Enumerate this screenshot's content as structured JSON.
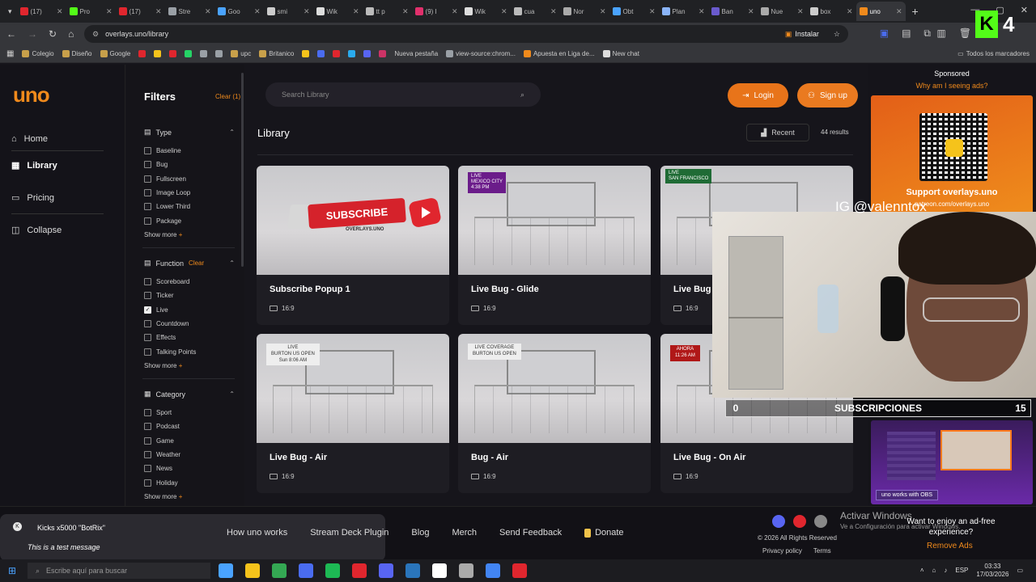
{
  "browser": {
    "tabs": [
      {
        "label": "(17)",
        "color": "#e0262e"
      },
      {
        "label": "Pro",
        "color": "#53fc18"
      },
      {
        "label": "(17)",
        "color": "#e0262e"
      },
      {
        "label": "Stre",
        "color": "#9aa0a6"
      },
      {
        "label": "Goo",
        "color": "#4aa3ff"
      },
      {
        "label": "smi",
        "color": "#cccccc"
      },
      {
        "label": "Wik",
        "color": "#dddddd"
      },
      {
        "label": "tt p",
        "color": "#bbbbbb"
      },
      {
        "label": "(9) I",
        "color": "#e1306c"
      },
      {
        "label": "Wik",
        "color": "#dddddd"
      },
      {
        "label": "cua",
        "color": "#bbbbbb"
      },
      {
        "label": "Nor",
        "color": "#aaaaaa"
      },
      {
        "label": "Obt",
        "color": "#4aa3ff"
      },
      {
        "label": "Plan",
        "color": "#8ab4f8"
      },
      {
        "label": "Ban",
        "color": "#6a5acd"
      },
      {
        "label": "Nue",
        "color": "#aaaaaa"
      },
      {
        "label": "box",
        "color": "#cccccc"
      },
      {
        "label": "uno",
        "color": "#f08a1c",
        "active": true
      }
    ],
    "url": "overlays.uno/library",
    "install_label": "Instalar",
    "bookmarks": [
      {
        "label": "Colegio",
        "color": "#c8a04a"
      },
      {
        "label": "Diseño",
        "color": "#c8a04a"
      },
      {
        "label": "Google",
        "color": "#c8a04a"
      },
      {
        "label": "",
        "color": "#e0262e"
      },
      {
        "label": "",
        "color": "#f5c31b"
      },
      {
        "label": "",
        "color": "#e0262e"
      },
      {
        "label": "",
        "color": "#25d366"
      },
      {
        "label": "",
        "color": "#9aa0a6"
      },
      {
        "label": "",
        "color": "#9aa0a6"
      },
      {
        "label": "upc",
        "color": "#c8a04a"
      },
      {
        "label": "Britanico",
        "color": "#c8a04a"
      },
      {
        "label": "",
        "color": "#f5c31b"
      },
      {
        "label": "",
        "color": "#4a6cf0"
      },
      {
        "label": "",
        "color": "#e0262e"
      },
      {
        "label": "",
        "color": "#2aabee"
      },
      {
        "label": "",
        "color": "#5865f2"
      },
      {
        "label": "",
        "color": "#cc3366"
      },
      {
        "label": "Nueva pestaña",
        "color": ""
      },
      {
        "label": "view-source:chrom...",
        "color": "#9aa0a6"
      },
      {
        "label": "Apuesta en Liga de...",
        "color": "#f08a1c"
      },
      {
        "label": "New chat",
        "color": "#dddddd"
      }
    ],
    "all_bookmarks": "Todos los marcadores"
  },
  "sidebar": {
    "logo": "uno",
    "items": [
      {
        "label": "Home",
        "icon": "⌂"
      },
      {
        "label": "Library",
        "icon": "▦",
        "active": true
      },
      {
        "label": "Pricing",
        "icon": "▭"
      },
      {
        "label": "Collapse",
        "icon": "◫"
      }
    ]
  },
  "filters": {
    "title": "Filters",
    "clear_all": "Clear (1)",
    "sections": [
      {
        "title": "Type",
        "clear": "",
        "options": [
          {
            "label": "Baseline",
            "checked": false
          },
          {
            "label": "Bug",
            "checked": false
          },
          {
            "label": "Fullscreen",
            "checked": false
          },
          {
            "label": "Image Loop",
            "checked": false
          },
          {
            "label": "Lower Third",
            "checked": false
          },
          {
            "label": "Package",
            "checked": false
          }
        ],
        "more": "Show more"
      },
      {
        "title": "Function",
        "clear": "Clear",
        "options": [
          {
            "label": "Scoreboard",
            "checked": false
          },
          {
            "label": "Ticker",
            "checked": false
          },
          {
            "label": "Live",
            "checked": true
          },
          {
            "label": "Countdown",
            "checked": false
          },
          {
            "label": "Effects",
            "checked": false
          },
          {
            "label": "Talking Points",
            "checked": false
          }
        ],
        "more": "Show more"
      },
      {
        "title": "Category",
        "clear": "",
        "options": [
          {
            "label": "Sport",
            "checked": false
          },
          {
            "label": "Podcast",
            "checked": false
          },
          {
            "label": "Game",
            "checked": false
          },
          {
            "label": "Weather",
            "checked": false
          },
          {
            "label": "News",
            "checked": false
          },
          {
            "label": "Holiday",
            "checked": false
          }
        ],
        "more": "Show more"
      }
    ]
  },
  "header": {
    "search_placeholder": "Search Library",
    "login": "Login",
    "signup": "Sign up"
  },
  "library": {
    "title": "Library",
    "sort": "Recent",
    "results": "44 results",
    "cards": [
      {
        "title": "Subscribe Popup 1",
        "ratio": "16:9",
        "badge": "",
        "subscribe_text": "SUBSCRIBE",
        "subscribe_sub": "OVERLAYS.UNO"
      },
      {
        "title": "Live Bug - Glide",
        "ratio": "16:9",
        "badge": "LIVE",
        "badge_sub": "MEXICO CITY\n4:38 PM"
      },
      {
        "title": "Live Bug -",
        "ratio": "16:9",
        "badge": "LIVE",
        "badge_sub": "SAN FRANCISCO"
      },
      {
        "title": "Live Bug - Air",
        "ratio": "16:9",
        "badge": "LIVE",
        "badge_sub": "BURTON US OPEN\nSun 8:06 AM"
      },
      {
        "title": "Bug - Air",
        "ratio": "16:9",
        "badge": "LIVE COVERAGE",
        "badge_sub": "BURTON US OPEN"
      },
      {
        "title": "Live Bug - On Air",
        "ratio": "16:9",
        "badge": "AHORA",
        "badge_sub": "11:26 AM"
      }
    ]
  },
  "ad": {
    "sponsored": "Sponsored",
    "why": "Why am I seeing ads?",
    "headline": "Support overlays.uno",
    "url": "patreon.com/overlays.uno",
    "obs_tag": "uno works with OBS"
  },
  "overlay": {
    "ig": "IG @valenntox",
    "sub_left": "0",
    "sub_label": "SUBSCRIPCIONES",
    "sub_right": "15",
    "kick_count": "4"
  },
  "footer": {
    "links": [
      "How uno works",
      "Stream Deck Plugin",
      "Blog",
      "Merch",
      "Send Feedback",
      "Donate"
    ],
    "copyright": "© 2026 All Rights Reserved",
    "privacy": "Privacy policy",
    "terms": "Terms",
    "activate": "Activar Windows",
    "activate_sub": "Ve a Configuración para activar Windows.",
    "enjoy": "Want to enjoy an ad-free experience?",
    "remove_ads": "Remove Ads"
  },
  "toast": {
    "line1": "Kicks x5000 \"BotRix\"",
    "line2": "This is a test message"
  },
  "taskbar": {
    "search_placeholder": "Escribe aquí para buscar",
    "lang": "ESP",
    "time": "03:33",
    "date": "17/03/2026",
    "apps": [
      "#4aa3ff",
      "#f5c31b",
      "#34a853",
      "#4a6cf0",
      "#1db954",
      "#e0262e",
      "#5865f2",
      "#2a75bb",
      "#ffffff",
      "#aaaaaa",
      "#4285f4",
      "#e0262e"
    ]
  }
}
